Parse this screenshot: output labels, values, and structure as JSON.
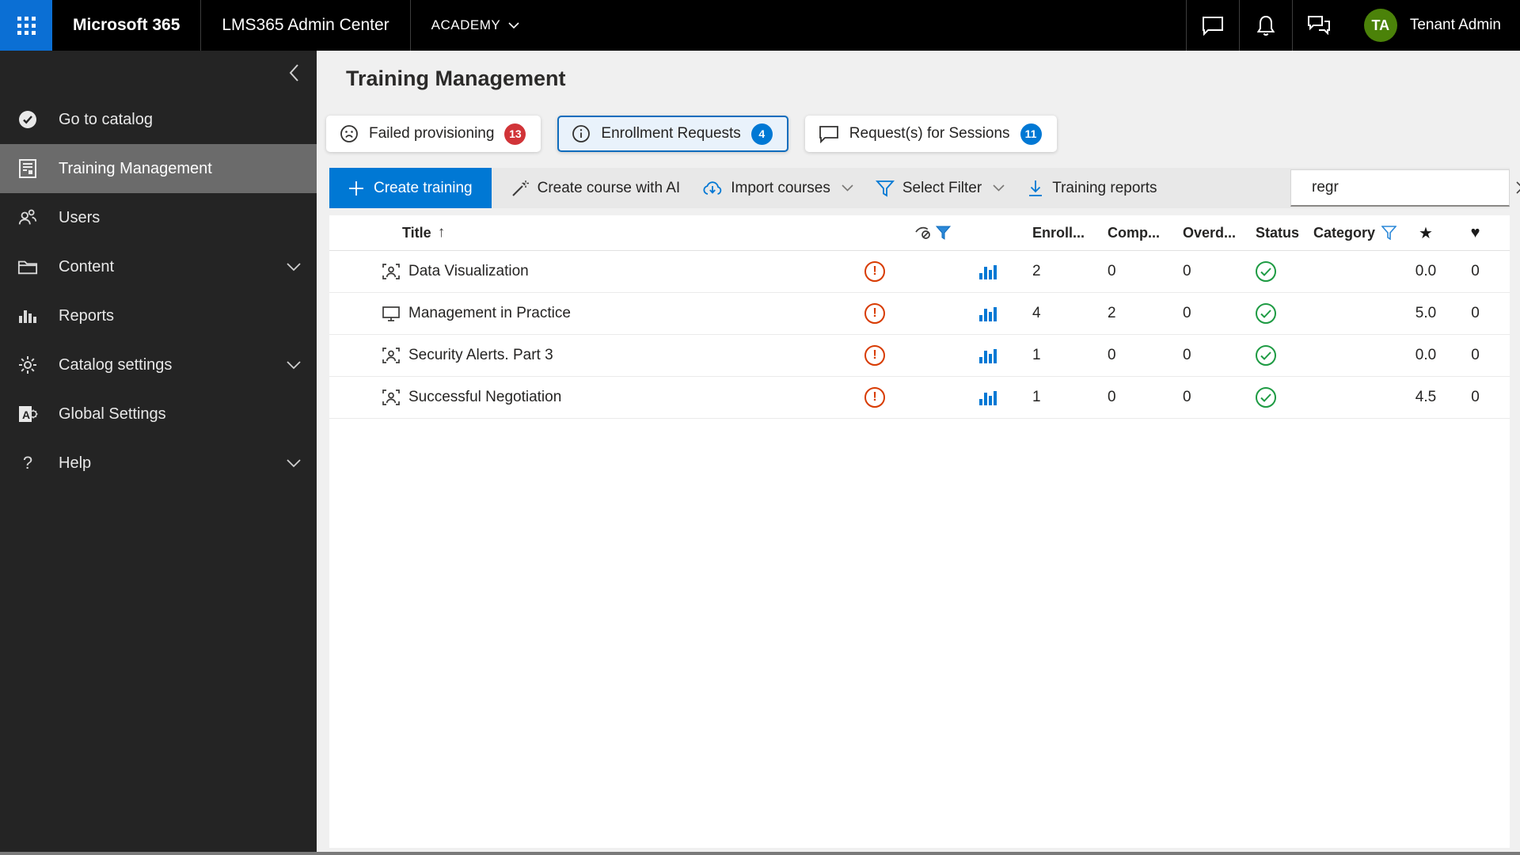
{
  "topbar": {
    "brand": "Microsoft 365",
    "app": "LMS365 Admin Center",
    "org": "ACADEMY",
    "user_initials": "TA",
    "user_name": "Tenant Admin"
  },
  "sidebar": {
    "items": [
      {
        "label": "Go to catalog",
        "selected": false,
        "expandable": false
      },
      {
        "label": "Training Management",
        "selected": true,
        "expandable": false
      },
      {
        "label": "Users",
        "selected": false,
        "expandable": false
      },
      {
        "label": "Content",
        "selected": false,
        "expandable": true
      },
      {
        "label": "Reports",
        "selected": false,
        "expandable": false
      },
      {
        "label": "Catalog settings",
        "selected": false,
        "expandable": true
      },
      {
        "label": "Global Settings",
        "selected": false,
        "expandable": false
      },
      {
        "label": "Help",
        "selected": false,
        "expandable": true
      }
    ]
  },
  "page": {
    "title": "Training Management",
    "tabs": [
      {
        "label": "Failed provisioning",
        "count": "13",
        "badge_color": "#d13438",
        "selected": false
      },
      {
        "label": "Enrollment Requests",
        "count": "4",
        "badge_color": "#0078d4",
        "selected": true
      },
      {
        "label": "Request(s) for Sessions",
        "count": "11",
        "badge_color": "#0078d4",
        "selected": false
      }
    ],
    "toolbar": {
      "create_training": "Create training",
      "create_course_ai": "Create course with AI",
      "import_courses": "Import courses",
      "select_filter": "Select Filter",
      "training_reports": "Training reports",
      "search_value": "regr"
    },
    "table": {
      "columns": {
        "title": "Title",
        "enrolled": "Enroll...",
        "completed": "Comp...",
        "overdue": "Overd...",
        "status": "Status",
        "category": "Category"
      },
      "rows": [
        {
          "title": "Data Visualization",
          "type": "instructor-led",
          "enrolled": "2",
          "completed": "0",
          "overdue": "0",
          "status": "published",
          "rating": "0.0",
          "likes": "0"
        },
        {
          "title": "Management in Practice",
          "type": "e-learning",
          "enrolled": "4",
          "completed": "2",
          "overdue": "0",
          "status": "published",
          "rating": "5.0",
          "likes": "0"
        },
        {
          "title": "Security Alerts. Part 3",
          "type": "instructor-led",
          "enrolled": "1",
          "completed": "0",
          "overdue": "0",
          "status": "published",
          "rating": "0.0",
          "likes": "0"
        },
        {
          "title": "Successful Negotiation",
          "type": "instructor-led",
          "enrolled": "1",
          "completed": "0",
          "overdue": "0",
          "status": "published",
          "rating": "4.5",
          "likes": "0"
        }
      ]
    }
  },
  "colors": {
    "accent_blue": "#0078d4",
    "selected_tab_border": "#0f6cbd",
    "badge_red": "#d13438",
    "warning_orange": "#d83b01",
    "status_green": "#1e9b43",
    "topbar_bg": "#000000",
    "sidebar_bg": "#242424",
    "sidebar_selected": "#6b6b6b"
  }
}
